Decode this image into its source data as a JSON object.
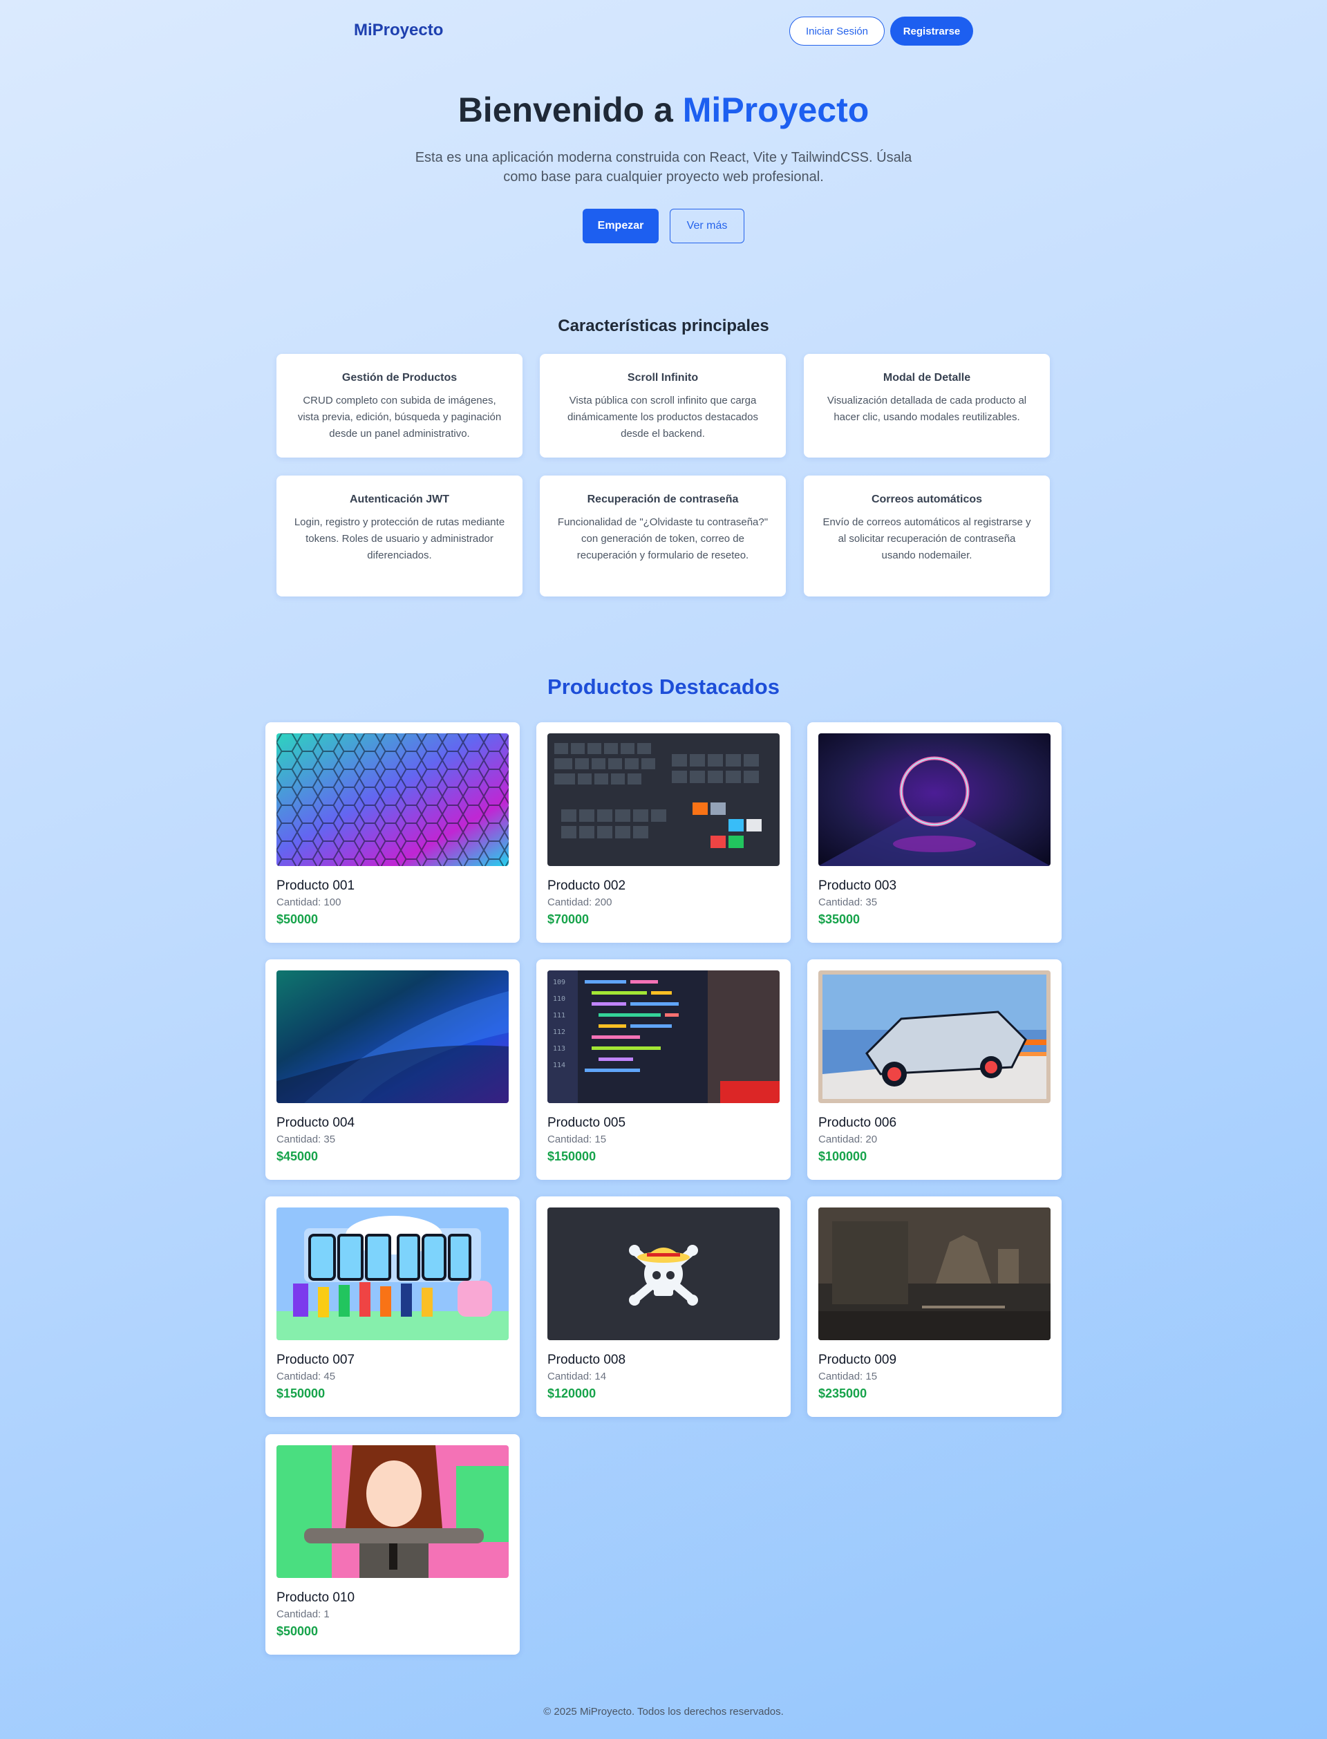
{
  "header": {
    "brand": "MiProyecto",
    "login_label": "Iniciar Sesión",
    "register_label": "Registrarse"
  },
  "hero": {
    "title_prefix": "Bienvenido a",
    "title_accent": "MiProyecto",
    "subtitle": "Esta es una aplicación moderna construida con React, Vite y TailwindCSS. Úsala como base para cualquier proyecto web profesional.",
    "start_label": "Empezar",
    "more_label": "Ver más"
  },
  "features": {
    "title": "Características principales",
    "items": [
      {
        "title": "Gestión de Productos",
        "desc": "CRUD completo con subida de imágenes, vista previa, edición, búsqueda y paginación desde un panel administrativo."
      },
      {
        "title": "Scroll Infinito",
        "desc": "Vista pública con scroll infinito que carga dinámicamente los productos destacados desde el backend."
      },
      {
        "title": "Modal de Detalle",
        "desc": "Visualización detallada de cada producto al hacer clic, usando modales reutilizables."
      },
      {
        "title": "Autenticación JWT",
        "desc": "Login, registro y protección de rutas mediante tokens. Roles de usuario y administrador diferenciados."
      },
      {
        "title": "Recuperación de contraseña",
        "desc": "Funcionalidad de \"¿Olvidaste tu contraseña?\" con generación de token, correo de recuperación y formulario de reseteo."
      },
      {
        "title": "Correos automáticos",
        "desc": "Envío de correos automáticos al registrarse y al solicitar recuperación de contraseña usando nodemailer."
      }
    ]
  },
  "products": {
    "title": "Productos Destacados",
    "qty_prefix": "Cantidad: ",
    "items": [
      {
        "name": "Producto 001",
        "qty": "Cantidad: 100",
        "price": "$50000",
        "image": "hexagon-wallpaper"
      },
      {
        "name": "Producto 002",
        "qty": "Cantidad: 200",
        "price": "$70000",
        "image": "keyboard-photo"
      },
      {
        "name": "Producto 003",
        "qty": "Cantidad: 35",
        "price": "$35000",
        "image": "neon-ring-tunnel"
      },
      {
        "name": "Producto 004",
        "qty": "Cantidad: 35",
        "price": "$45000",
        "image": "blue-abstract-wave"
      },
      {
        "name": "Producto 005",
        "qty": "Cantidad: 15",
        "price": "$150000",
        "image": "code-on-screen"
      },
      {
        "name": "Producto 006",
        "qty": "Cantidad: 20",
        "price": "$100000",
        "image": "delorean-illustration"
      },
      {
        "name": "Producto 007",
        "qty": "Cantidad: 45",
        "price": "$150000",
        "image": "one-piece-banner"
      },
      {
        "name": "Producto 008",
        "qty": "Cantidad: 14",
        "price": "$120000",
        "image": "straw-hat-skull-flag"
      },
      {
        "name": "Producto 009",
        "qty": "Cantidad: 15",
        "price": "$235000",
        "image": "dark-temple-scene"
      },
      {
        "name": "Producto 010",
        "qty": "Cantidad: 1",
        "price": "$50000",
        "image": "anime-character-art"
      }
    ]
  },
  "footer": {
    "text": "© 2025 MiProyecto. Todos los derechos reservados."
  },
  "colors": {
    "primary": "#1d5ff0",
    "brand": "#1e40af",
    "price": "#16a34a",
    "products_title": "#1d4ed8"
  }
}
